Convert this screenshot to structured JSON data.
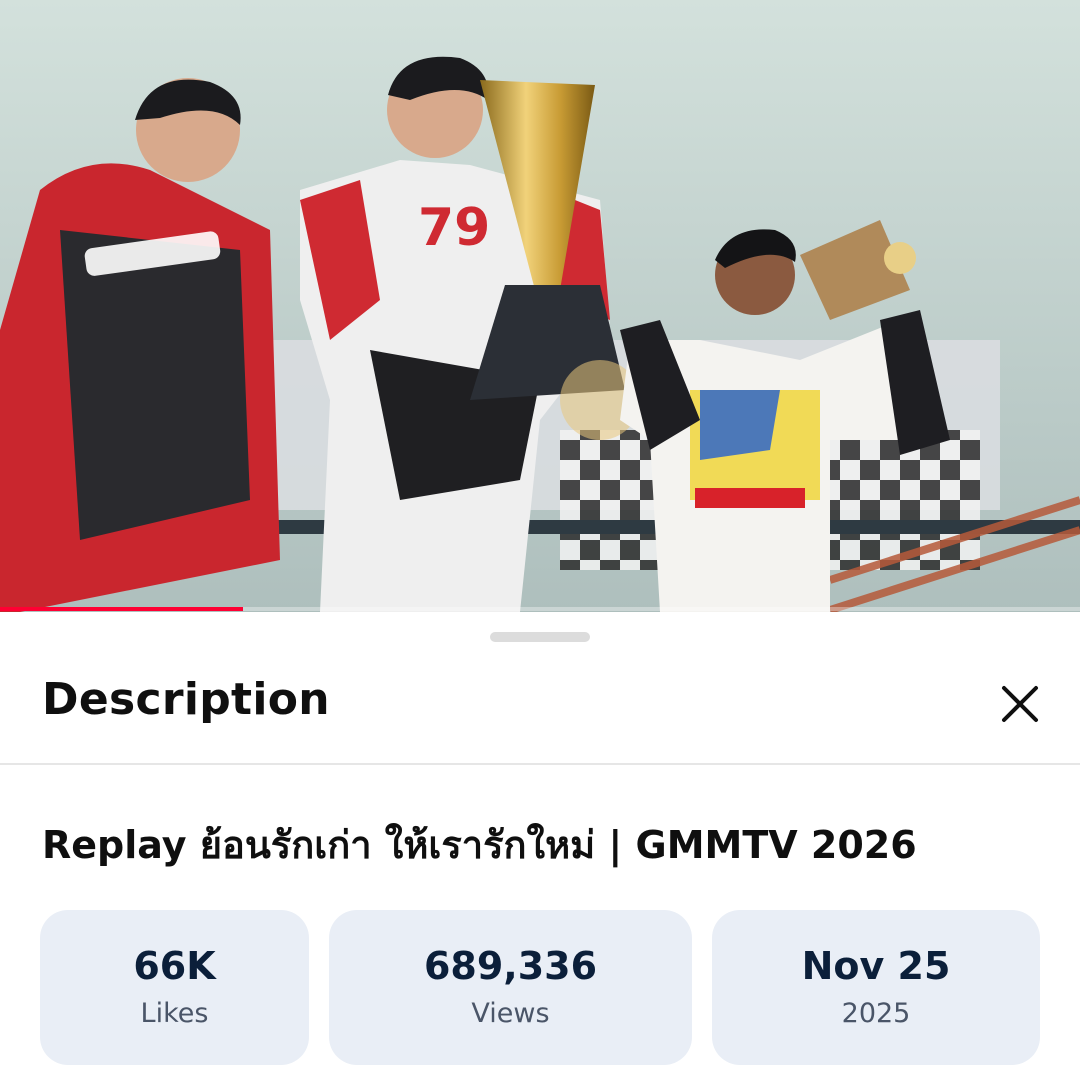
{
  "video": {
    "progress_fraction": 0.225
  },
  "sheet": {
    "title": "Description",
    "video_title": "Replay ย้อนรักเก่า ให้เรารักใหม่ | GMMTV 2026"
  },
  "stats": [
    {
      "value": "66K",
      "label": "Likes"
    },
    {
      "value": "689,336",
      "label": "Views"
    },
    {
      "value": "Nov 25",
      "label": "2025"
    }
  ],
  "colors": {
    "accent_red": "#ff0033",
    "stat_card_bg": "#e9eef6",
    "stat_value": "#0b1f3a"
  },
  "icons": {
    "close": "close-icon"
  }
}
